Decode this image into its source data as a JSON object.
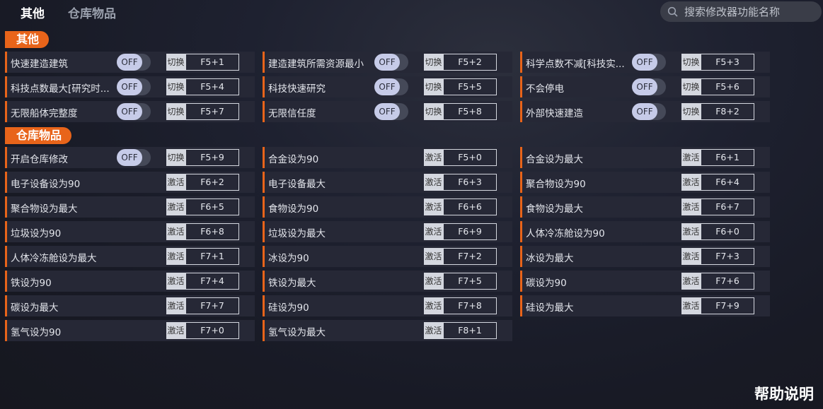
{
  "tabs": [
    {
      "label": "其他",
      "active": true
    },
    {
      "label": "仓库物品",
      "active": false
    }
  ],
  "search": {
    "placeholder": "搜索修改器功能名称"
  },
  "sections": [
    {
      "title": "其他"
    },
    {
      "title": "仓库物品"
    }
  ],
  "rows_other": [
    [
      {
        "label": "快速建造建筑",
        "toggle": "OFF",
        "action": "切换",
        "key": "F5+1"
      },
      {
        "label": "建造建筑所需资源最小",
        "toggle": "OFF",
        "action": "切换",
        "key": "F5+2"
      },
      {
        "label": "科学点数不减[科技实...",
        "toggle": "OFF",
        "action": "切换",
        "key": "F5+3"
      }
    ],
    [
      {
        "label": "科技点数最大[研究时...",
        "toggle": "OFF",
        "action": "切换",
        "key": "F5+4"
      },
      {
        "label": "科技快速研究",
        "toggle": "OFF",
        "action": "切换",
        "key": "F5+5"
      },
      {
        "label": "不会停电",
        "toggle": "OFF",
        "action": "切换",
        "key": "F5+6"
      }
    ],
    [
      {
        "label": "无限船体完整度",
        "toggle": "OFF",
        "action": "切换",
        "key": "F5+7"
      },
      {
        "label": "无限信任度",
        "toggle": "OFF",
        "action": "切换",
        "key": "F5+8"
      },
      {
        "label": "外部快速建造",
        "toggle": "OFF",
        "action": "切换",
        "key": "F8+2"
      }
    ]
  ],
  "rows_storage": [
    [
      {
        "label": "开启仓库修改",
        "toggle": "OFF",
        "action": "切换",
        "key": "F5+9"
      },
      {
        "label": "合金设为90",
        "action": "激活",
        "key": "F5+0"
      },
      {
        "label": "合金设为最大",
        "action": "激活",
        "key": "F6+1"
      }
    ],
    [
      {
        "label": "电子设备设为90",
        "action": "激活",
        "key": "F6+2"
      },
      {
        "label": "电子设备最大",
        "action": "激活",
        "key": "F6+3"
      },
      {
        "label": "聚合物设为90",
        "action": "激活",
        "key": "F6+4"
      }
    ],
    [
      {
        "label": "聚合物设为最大",
        "action": "激活",
        "key": "F6+5"
      },
      {
        "label": "食物设为90",
        "action": "激活",
        "key": "F6+6"
      },
      {
        "label": "食物设为最大",
        "action": "激活",
        "key": "F6+7"
      }
    ],
    [
      {
        "label": "垃圾设为90",
        "action": "激活",
        "key": "F6+8"
      },
      {
        "label": "垃圾设为最大",
        "action": "激活",
        "key": "F6+9"
      },
      {
        "label": "人体冷冻舱设为90",
        "action": "激活",
        "key": "F6+0"
      }
    ],
    [
      {
        "label": "人体冷冻舱设为最大",
        "action": "激活",
        "key": "F7+1"
      },
      {
        "label": "冰设为90",
        "action": "激活",
        "key": "F7+2"
      },
      {
        "label": "冰设为最大",
        "action": "激活",
        "key": "F7+3"
      }
    ],
    [
      {
        "label": "铁设为90",
        "action": "激活",
        "key": "F7+4"
      },
      {
        "label": "铁设为最大",
        "action": "激活",
        "key": "F7+5"
      },
      {
        "label": "碳设为90",
        "action": "激活",
        "key": "F7+6"
      }
    ],
    [
      {
        "label": "碳设为最大",
        "action": "激活",
        "key": "F7+7"
      },
      {
        "label": "硅设为90",
        "action": "激活",
        "key": "F7+8"
      },
      {
        "label": "硅设为最大",
        "action": "激活",
        "key": "F7+9"
      }
    ],
    [
      {
        "label": "氢气设为90",
        "action": "激活",
        "key": "F7+0"
      },
      {
        "label": "氢气设为最大",
        "action": "激活",
        "key": "F8+1"
      }
    ]
  ],
  "help": {
    "label": "帮助说明"
  },
  "colors": {
    "accent": "#e8641a",
    "cell_bg": "#262836",
    "toggle_knob": "#c6cbe8"
  }
}
